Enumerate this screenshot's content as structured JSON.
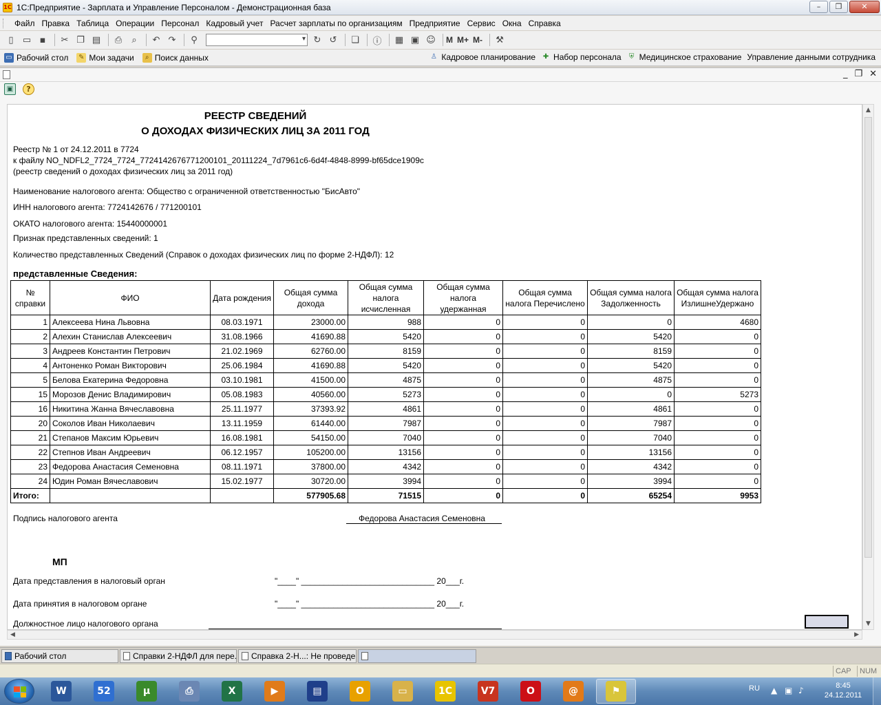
{
  "window": {
    "title": "1С:Предприятие - Зарплата и Управление Персоналом - Демонстрационная база"
  },
  "menu": [
    {
      "label": "Файл"
    },
    {
      "label": "Правка"
    },
    {
      "label": "Таблица"
    },
    {
      "label": "Операции"
    },
    {
      "label": "Персонал"
    },
    {
      "label": "Кадровый учет"
    },
    {
      "label": "Расчет зарплаты по организациям"
    },
    {
      "label": "Предприятие"
    },
    {
      "label": "Сервис"
    },
    {
      "label": "Окна"
    },
    {
      "label": "Справка"
    }
  ],
  "toolbar": {
    "memory_buttons": [
      "M",
      "M+",
      "M-"
    ]
  },
  "panel": {
    "left": [
      {
        "label": "Рабочий стол",
        "icon": "desktop-icon"
      },
      {
        "label": "Мои задачи",
        "icon": "tasks-icon"
      },
      {
        "label": "Поиск данных",
        "icon": "search-data-icon"
      }
    ],
    "right": [
      {
        "label": "Кадровое планирование",
        "icon": "planning-icon"
      },
      {
        "label": "Набор персонала",
        "icon": "recruit-icon"
      },
      {
        "label": "Медицинское страхование",
        "icon": "medical-icon"
      },
      {
        "label": "Управление данными сотрудника",
        "icon": "employee-data-icon"
      }
    ]
  },
  "report": {
    "title_line1": "РЕЕСТР СВЕДЕНИЙ",
    "title_line2": "О ДОХОДАХ ФИЗИЧЕСКИХ ЛИЦ ЗА 2011 ГОД",
    "registry_line": "Реестр № 1 от 24.12.2011 в 7724",
    "file_line": "к файлу NO_NDFL2_7724_7724_7724142676771200101_20111224_7d7961c6-6d4f-4848-8999-bf65dce1909c",
    "file_note": "(реестр сведений о доходах физических лиц за 2011 год)",
    "agent_name": "Наименование налогового агента: Общество с ограниченной ответственностью \"БисАвто\"",
    "agent_inn": "ИНН налогового агента: 7724142676 / 771200101",
    "agent_okato": "ОКАТО налогового агента: 15440000001",
    "sign_flag": "Признак представленных сведений: 1",
    "count_line": "Количество представленных Сведений (Справок о доходах физических лиц по форме 2-НДФЛ): 12",
    "section_title": "представленные Сведения:",
    "columns": [
      "№ справки",
      "ФИО",
      "Дата рождения",
      "Общая сумма дохода",
      "Общая сумма налога исчисленная",
      "Общая сумма налога удержанная",
      "Общая сумма налога Перечислено",
      "Общая сумма налога Задолженность",
      "Общая сумма налога ИзлишнеУдержано"
    ],
    "rows": [
      [
        "1",
        "Алексеева Нина Львовна",
        "08.03.1971",
        "23000.00",
        "988",
        "0",
        "0",
        "0",
        "4680"
      ],
      [
        "2",
        "Алехин Станислав Алексеевич",
        "31.08.1966",
        "41690.88",
        "5420",
        "0",
        "0",
        "5420",
        "0"
      ],
      [
        "3",
        "Андреев Константин Петрович",
        "21.02.1969",
        "62760.00",
        "8159",
        "0",
        "0",
        "8159",
        "0"
      ],
      [
        "4",
        "Антоненко Роман Викторович",
        "25.06.1984",
        "41690.88",
        "5420",
        "0",
        "0",
        "5420",
        "0"
      ],
      [
        "5",
        "Белова Екатерина Федоровна",
        "03.10.1981",
        "41500.00",
        "4875",
        "0",
        "0",
        "4875",
        "0"
      ],
      [
        "15",
        "Морозов Денис Владимирович",
        "05.08.1983",
        "40560.00",
        "5273",
        "0",
        "0",
        "0",
        "5273"
      ],
      [
        "16",
        "Никитина Жанна Вячеславовна",
        "25.11.1977",
        "37393.92",
        "4861",
        "0",
        "0",
        "4861",
        "0"
      ],
      [
        "20",
        "Соколов Иван Николаевич",
        "13.11.1959",
        "61440.00",
        "7987",
        "0",
        "0",
        "7987",
        "0"
      ],
      [
        "21",
        "Степанов Максим Юрьевич",
        "16.08.1981",
        "54150.00",
        "7040",
        "0",
        "0",
        "7040",
        "0"
      ],
      [
        "22",
        "Степнов Иван Андреевич",
        "06.12.1957",
        "105200.00",
        "13156",
        "0",
        "0",
        "13156",
        "0"
      ],
      [
        "23",
        "Федорова Анастасия Семеновна",
        "08.11.1971",
        "37800.00",
        "4342",
        "0",
        "0",
        "4342",
        "0"
      ],
      [
        "24",
        "Юдин Роман Вячеславович",
        "15.02.1977",
        "30720.00",
        "3994",
        "0",
        "0",
        "3994",
        "0"
      ]
    ],
    "total": [
      "Итого:",
      "",
      "",
      "577905.68",
      "71515",
      "0",
      "0",
      "65254",
      "9953"
    ],
    "signature_label": "Подпись налогового агента",
    "signature_name": "Федорова Анастасия Семеновна",
    "mp": "МП",
    "date_submit_label": "Дата представления в налоговый орган",
    "date_accept_label": "Дата принятия в налоговом органе",
    "date_template": "\"____\" _____________________________ 20___г.",
    "official_label": "Должностное лицо налогового органа"
  },
  "open_windows": [
    {
      "label": "Рабочий стол"
    },
    {
      "label": "Справки 2-НДФЛ для пере..."
    },
    {
      "label": "Справка 2-Н...: Не проведен"
    },
    {
      "label": ""
    }
  ],
  "status": {
    "cap": "CAP",
    "num": "NUM"
  },
  "taskbar": {
    "apps": [
      {
        "icon": "word-icon",
        "glyph": "W",
        "color": "#2b579a"
      },
      {
        "icon": "calc-52-icon",
        "glyph": "52",
        "color": "#2f6fd1"
      },
      {
        "icon": "utorrent-icon",
        "glyph": "µ",
        "color": "#3a8a2b"
      },
      {
        "icon": "scanner-icon",
        "glyph": "⎙",
        "color": "#6b87b3"
      },
      {
        "icon": "excel-icon",
        "glyph": "X",
        "color": "#217346"
      },
      {
        "icon": "media-player-icon",
        "glyph": "▶",
        "color": "#e07b1a"
      },
      {
        "icon": "save-disk-icon",
        "glyph": "▤",
        "color": "#1f3f8a"
      },
      {
        "icon": "outlook-icon",
        "glyph": "O",
        "color": "#e8a100"
      },
      {
        "icon": "explorer-icon",
        "glyph": "▭",
        "color": "#d8b24a"
      },
      {
        "icon": "1c-icon",
        "glyph": "1С",
        "color": "#e8c400"
      },
      {
        "icon": "v7-icon",
        "glyph": "V7",
        "color": "#c8341f"
      },
      {
        "icon": "opera-icon",
        "glyph": "O",
        "color": "#cc0f16"
      },
      {
        "icon": "mail-at-icon",
        "glyph": "@",
        "color": "#e27a18"
      },
      {
        "icon": "1c-enterprise-icon",
        "glyph": "⚑",
        "color": "#d9c53a"
      }
    ],
    "lang": "RU",
    "time": "8:45",
    "date": "24.12.2011"
  }
}
